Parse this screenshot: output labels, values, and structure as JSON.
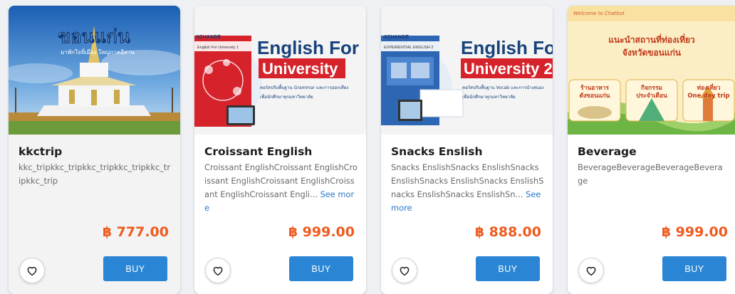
{
  "colors": {
    "price": "#ef5b1f",
    "buy_button": "#2a86d4",
    "link": "#2a78c9"
  },
  "cards": [
    {
      "title": "kkctrip",
      "description": "kkc_tripkkc_tripkkc_tripkkc_tripkkc_tripkkc_trip",
      "see_more": "",
      "price": "฿ 777.00",
      "buy_label": "BUY",
      "image": {
        "headline": "ขอนแก่น",
        "tagline": "มาพักใจที่เมือง ใหญ่ภาคอีสาน",
        "icon": "temple-image"
      }
    },
    {
      "title": "Croissant English",
      "description": "Croissant EnglishCroissant EnglishCroissant EnglishCroissant EnglishCroissant EnglishCroissant Engli...",
      "see_more": "See more",
      "price": "฿ 999.00",
      "buy_label": "BUY",
      "image": {
        "badge": "XCHANGE",
        "book_caption": "English For University 1",
        "headline_line1": "English For",
        "headline_line2": "University",
        "body_line1": "คอร์สปรับพื้นฐาน Grammar และการออกเสียง",
        "body_line2": "เพื่อนักศึกษาทุกมหาวิทยาลัย"
      }
    },
    {
      "title": "Snacks Enslish",
      "description": "Snacks EnslishSnacks EnslishSnacks EnslishSnacks EnslishSnacks EnslishSnacks EnslishSnacks EnslishSn...",
      "see_more": "See more",
      "price": "฿ 888.00",
      "buy_label": "BUY",
      "image": {
        "badge": "XCHANGE",
        "book_caption": "EXPERIENTIAL ENGLISH 2",
        "headline_line1": "English Fo",
        "headline_line2": "University 2",
        "body_line1": "คอร์สปรับพื้นฐาน Vocab และการนำเสนอง",
        "body_line2": "เพื่อนักศึกษาทุกมหาวิทยาลัย"
      }
    },
    {
      "title": "Beverage",
      "description": "BeverageBeverageBeverageBeverage",
      "see_more": "",
      "price": "฿ 999.00",
      "buy_label": "BUY",
      "image": {
        "welcome": "Welcome to Chatbot",
        "headline_line1": "แนะนำสถานที่ท่องเที่ยว",
        "headline_line2": "จังหวัดขอนแก่น",
        "label1_line1": "ร้านอาหาร",
        "label1_line2": "ดังขอนแก่น",
        "label2_line1": "กิจกรรม",
        "label2_line2": "ประจำเดือน",
        "label3_line1": "ท่องเที่ยว",
        "label3_line2": "One day trip"
      }
    }
  ]
}
